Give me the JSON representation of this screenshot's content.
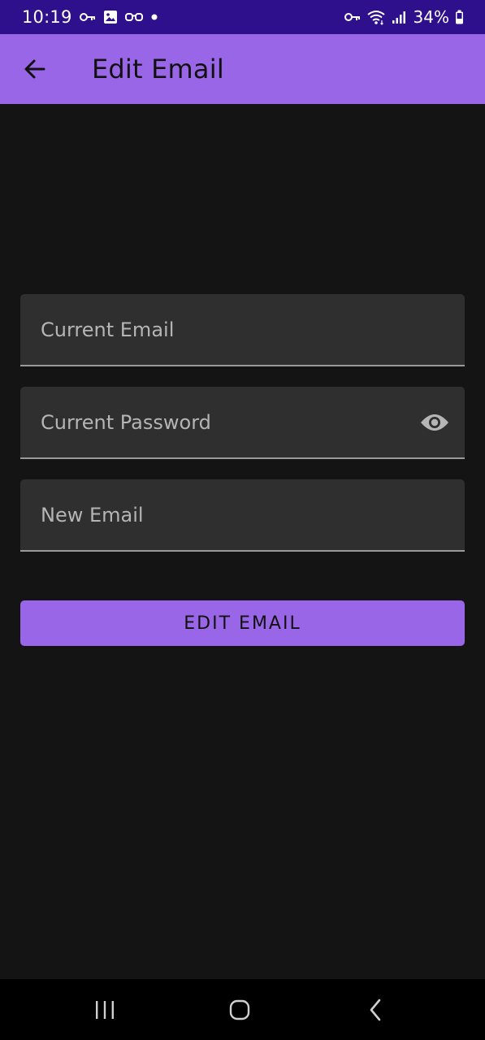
{
  "status_bar": {
    "time": "10:19",
    "battery": "34%",
    "left_icons": [
      "key-icon",
      "image-icon",
      "glasses-icon",
      "dot-icon"
    ],
    "right_icons": [
      "key-icon",
      "wifi-icon",
      "signal-icon",
      "battery-icon"
    ]
  },
  "app_bar": {
    "title": "Edit Email",
    "back_icon": "arrow-back-icon",
    "background": "#9966e8"
  },
  "form": {
    "current_email_placeholder": "Current Email",
    "current_email_value": "",
    "current_password_placeholder": "Current Password",
    "current_password_value": "",
    "password_toggle_icon": "eye-icon",
    "new_email_placeholder": "New Email",
    "new_email_value": "",
    "submit_label": "EDIT EMAIL"
  },
  "nav_bar": {
    "buttons": [
      "recents-icon",
      "home-icon",
      "back-icon"
    ]
  },
  "colors": {
    "status_bar": "#2e0f8c",
    "accent": "#9966e8",
    "background": "#141414",
    "field_background": "#2f2f2f"
  }
}
